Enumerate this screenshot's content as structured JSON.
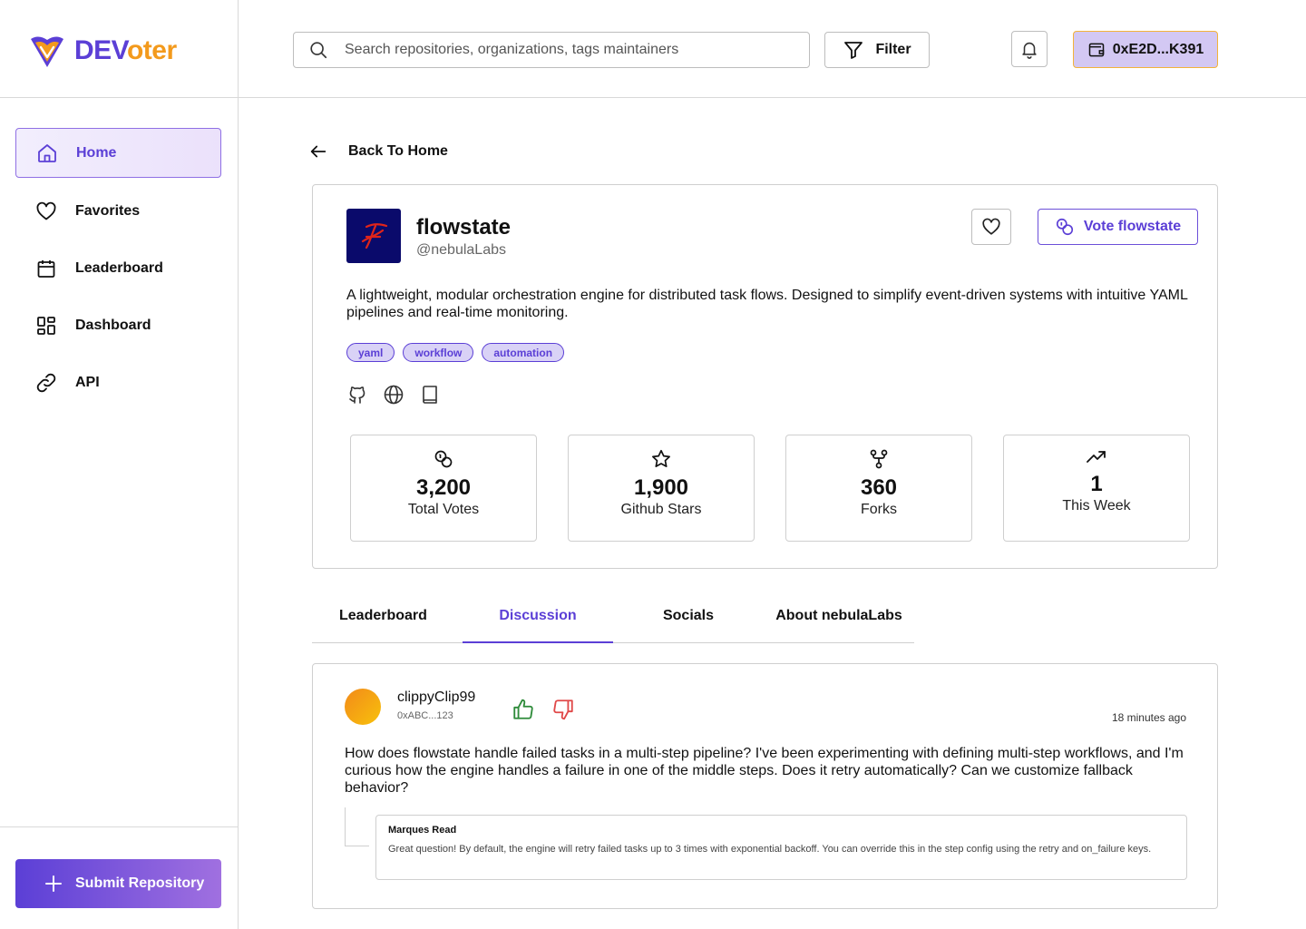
{
  "app": {
    "logo_primary": "DEV",
    "logo_secondary": "oter",
    "brand_color": "#5b3fd6",
    "accent_color": "#f39a1c"
  },
  "sidebar": {
    "items": [
      {
        "label": "Home",
        "icon": "home-icon",
        "active": true
      },
      {
        "label": "Favorites",
        "icon": "heart-icon"
      },
      {
        "label": "Leaderboard",
        "icon": "calendar-icon"
      },
      {
        "label": "Dashboard",
        "icon": "dashboard-grid-icon"
      },
      {
        "label": "API",
        "icon": "link-icon"
      }
    ],
    "submit_label": "Submit Repository"
  },
  "header": {
    "search_placeholder": "Search repositories, organizations, tags maintainers",
    "filter_label": "Filter",
    "wallet_address": "0xE2D...K391"
  },
  "back_label": "Back To Home",
  "project": {
    "name": "flowstate",
    "handle": "@nebulaLabs",
    "vote_label": "Vote flowstate",
    "description": "A lightweight, modular orchestration engine for distributed task flows. Designed to simplify event-driven systems with intuitive YAML pipelines and real-time monitoring.",
    "tags": [
      "yaml",
      "workflow",
      "automation"
    ],
    "stats": [
      {
        "value": "3,200",
        "label": "Total Votes",
        "icon": "coins-icon"
      },
      {
        "value": "1,900",
        "label": "Github Stars",
        "icon": "star-icon"
      },
      {
        "value": "360",
        "label": "Forks",
        "icon": "fork-icon"
      },
      {
        "value": "1",
        "label": "This Week",
        "icon": "trending-up-icon"
      }
    ]
  },
  "tabs": [
    {
      "label": "Leaderboard"
    },
    {
      "label": "Discussion",
      "active": true
    },
    {
      "label": "Socials"
    },
    {
      "label": "About nebulaLabs"
    }
  ],
  "discussion": {
    "username": "clippyClip99",
    "address": "0xABC...123",
    "time": "18 minutes ago",
    "comment": "How does flowstate handle failed tasks in a multi-step pipeline? I've been experimenting with defining multi-step workflows, and I'm curious how the engine handles a failure in one of the middle steps. Does it retry automatically? Can we customize fallback behavior?",
    "reply": {
      "author": "Marques Read",
      "text": "Great question! By default, the engine will retry failed tasks up to 3 times with exponential backoff. You can override this in the step config using the retry and on_failure keys."
    }
  }
}
